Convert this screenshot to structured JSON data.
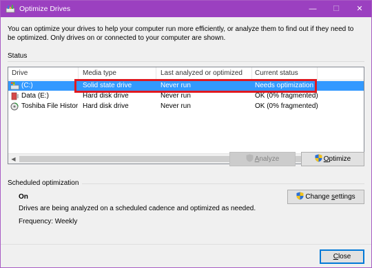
{
  "window": {
    "title": "Optimize Drives",
    "controls": {
      "minimize": "—",
      "maximize": "☐",
      "close": "✕"
    }
  },
  "description": "You can optimize your drives to help your computer run more efficiently, or analyze them to find out if they need to be optimized. Only drives on or connected to your computer are shown.",
  "status": {
    "label": "Status",
    "columns": [
      "Drive",
      "Media type",
      "Last analyzed or optimized",
      "Current status"
    ],
    "rows": [
      {
        "drive": "(C:)",
        "media": "Solid state drive",
        "last": "Never run",
        "status": "Needs optimization",
        "icon": "system-drive-icon",
        "selected": true
      },
      {
        "drive": "Data (E:)",
        "media": "Hard disk drive",
        "last": "Never run",
        "status": "OK (0% fragmented)",
        "icon": "removable-drive-icon",
        "selected": false
      },
      {
        "drive": "Toshiba File Histor...",
        "media": "Hard disk drive",
        "last": "Never run",
        "status": "OK (0% fragmented)",
        "icon": "backup-drive-icon",
        "selected": false
      }
    ]
  },
  "buttons": {
    "analyze": {
      "prefix": "",
      "accel": "A",
      "rest": "nalyze"
    },
    "optimize": {
      "prefix": "",
      "accel": "O",
      "rest": "ptimize"
    },
    "change_settings": {
      "prefix": "Change ",
      "accel": "s",
      "rest": "ettings"
    },
    "close": {
      "prefix": "",
      "accel": "C",
      "rest": "lose"
    }
  },
  "scheduled": {
    "label": "Scheduled optimization",
    "state": "On",
    "description": "Drives are being analyzed on a scheduled cadence and optimized as needed.",
    "frequency": "Frequency: Weekly"
  },
  "colors": {
    "titlebar": "#9b40c0",
    "selection": "#3399ff",
    "highlight": "#e0191f"
  }
}
